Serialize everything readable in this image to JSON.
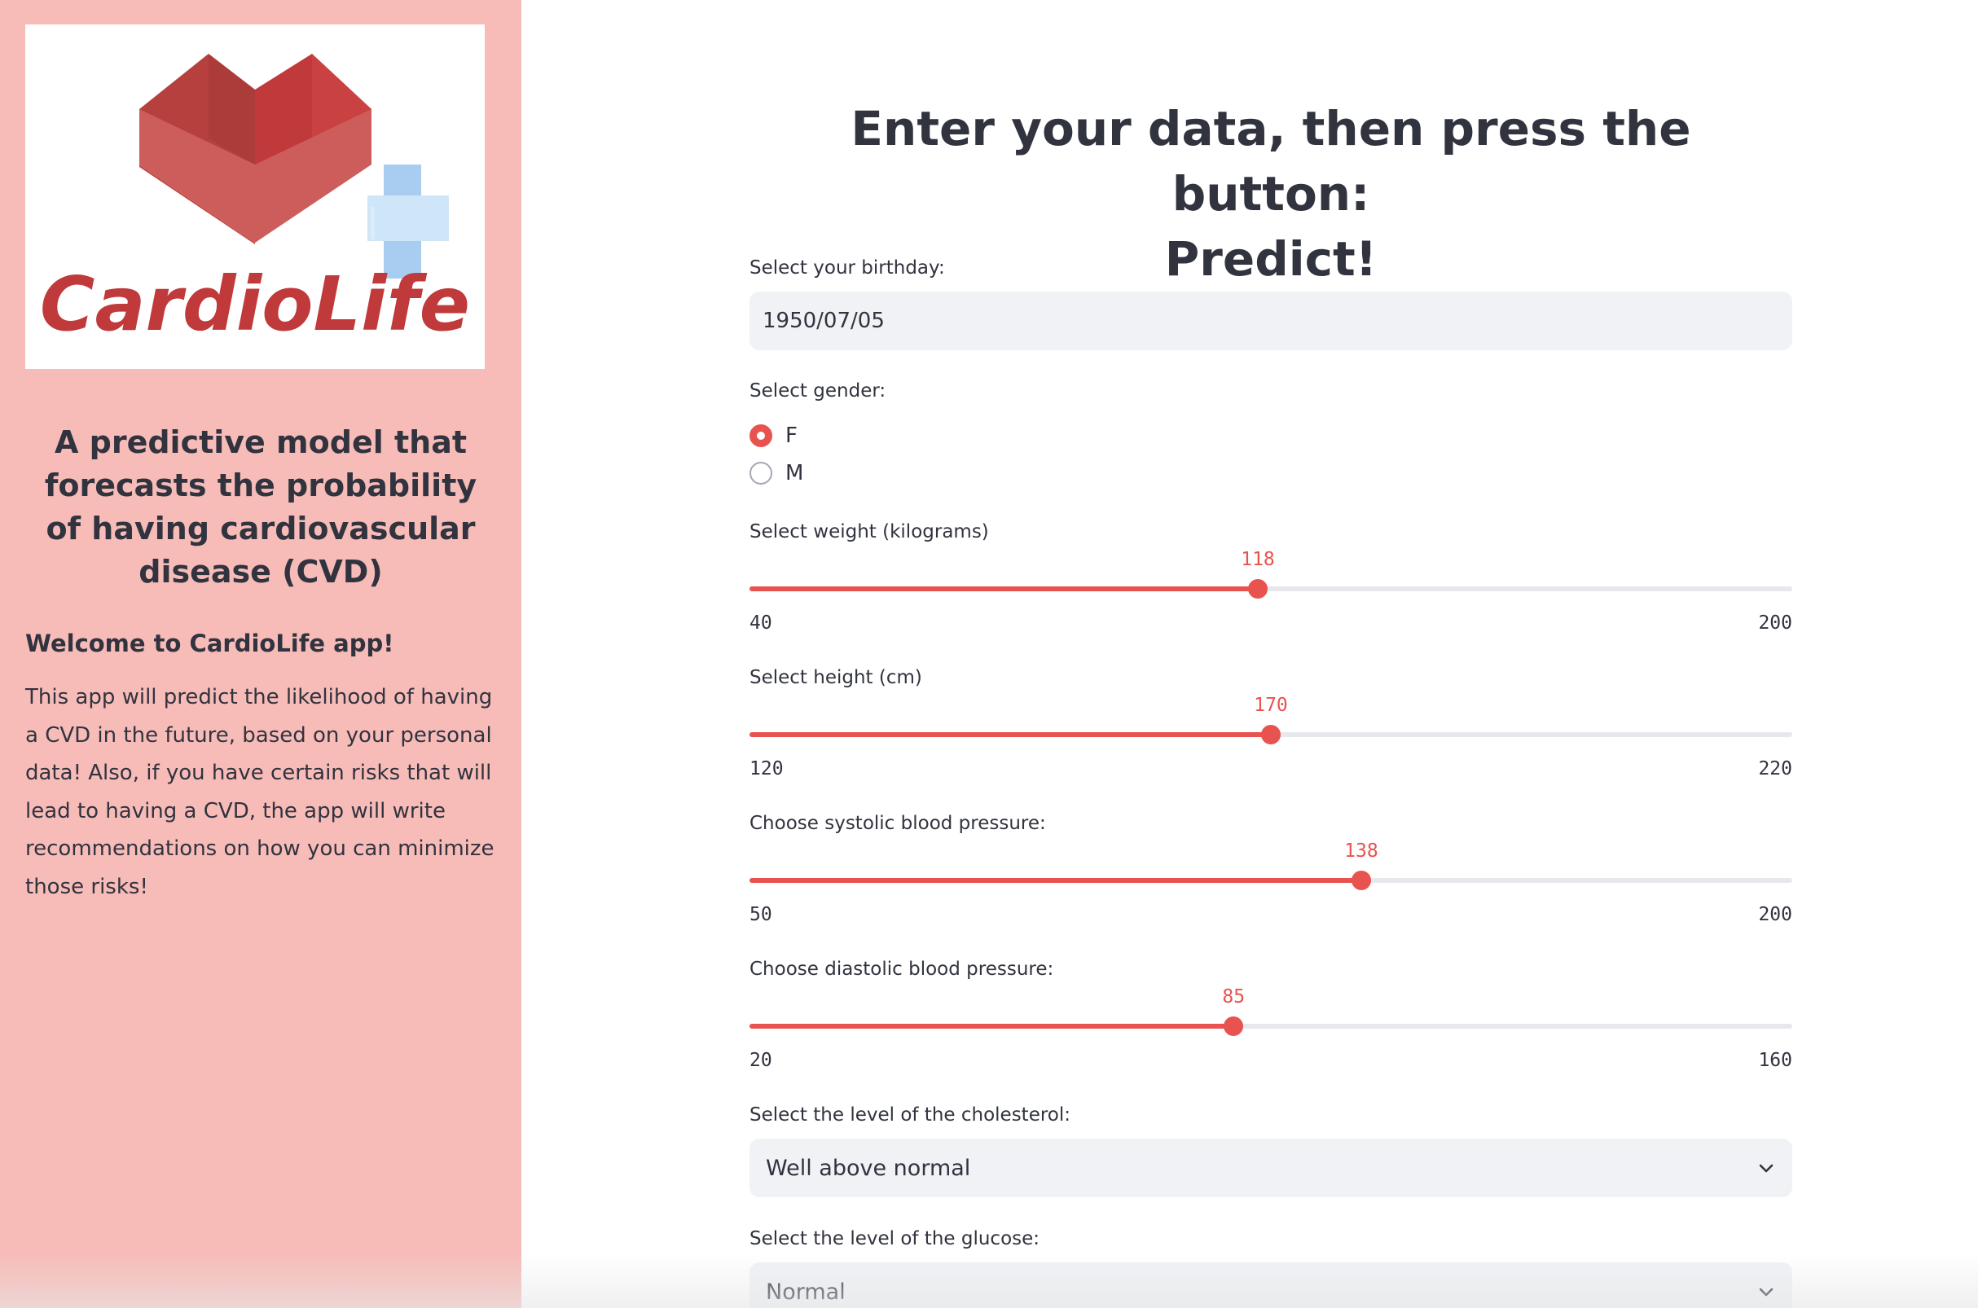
{
  "sidebar": {
    "logo_text": "CardioLife",
    "title": "A predictive model that forecasts the probability of having cardiovascular disease (CVD)",
    "welcome": "Welcome to CardioLife app!",
    "description": "This app will predict the likelihood of having a CVD in the future, based on your personal data! Also, if you have certain risks that will lead to having a CVD, the app will write recommendations on how you can minimize those risks!"
  },
  "main": {
    "title_line1": "Enter your data, then press the button:",
    "title_line2": "Predict!",
    "birthday": {
      "label": "Select your birthday:",
      "value": "1950/07/05"
    },
    "gender": {
      "label": "Select gender:",
      "options": [
        {
          "label": "F",
          "selected": true
        },
        {
          "label": "M",
          "selected": false
        }
      ]
    },
    "weight": {
      "label": "Select weight (kilograms)",
      "value": 118,
      "min": 40,
      "max": 200
    },
    "height": {
      "label": "Select height (cm)",
      "value": 170,
      "min": 120,
      "max": 220
    },
    "systolic": {
      "label": "Choose systolic blood pressure:",
      "value": 138,
      "min": 50,
      "max": 200
    },
    "diastolic": {
      "label": "Choose diastolic blood pressure:",
      "value": 85,
      "min": 20,
      "max": 160
    },
    "cholesterol": {
      "label": "Select the level of the cholesterol:",
      "value": "Well above normal"
    },
    "glucose": {
      "label": "Select the level of the glucose:",
      "value": "Normal"
    }
  },
  "colors": {
    "accent": "#e8534f",
    "sidebar_bg": "#f7bcb8",
    "logo_red": "#c0393b",
    "logo_blue": "#a8cdf0"
  },
  "icons": {
    "select_arrow": "chevron-down-icon"
  }
}
